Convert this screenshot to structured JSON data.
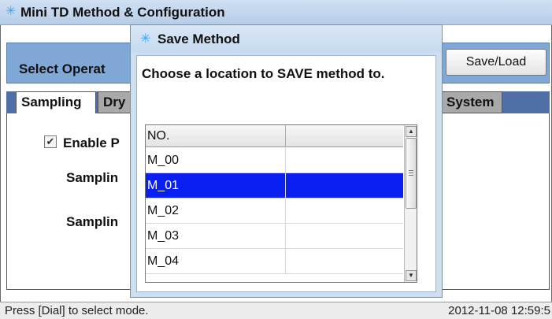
{
  "main_window": {
    "title": "Mini TD Method & Configuration",
    "select_operation_label": "Select Operat",
    "saveload_label": "Save/Load",
    "tabs": [
      {
        "label": "Sampling",
        "active": true
      },
      {
        "label": "Dry",
        "active": false
      },
      {
        "label": "System",
        "active": false
      }
    ],
    "enable_label": "Enable P",
    "enable_checked": true,
    "sampling_label_1": "Samplin",
    "sampling_label_2": "Samplin"
  },
  "status_bar": {
    "message": "Press [Dial] to select mode.",
    "datetime": "2012-11-08 12:59:5"
  },
  "dialog": {
    "title": "Save Method",
    "prompt": "Choose a location to SAVE method to.",
    "table": {
      "columns": [
        "NO.",
        ""
      ],
      "rows": [
        {
          "no": "M_00",
          "value": "",
          "selected": false
        },
        {
          "no": "M_01",
          "value": "",
          "selected": true
        },
        {
          "no": "M_02",
          "value": "",
          "selected": false
        },
        {
          "no": "M_03",
          "value": "",
          "selected": false
        },
        {
          "no": "M_04",
          "value": "",
          "selected": false
        }
      ]
    }
  },
  "colors": {
    "selection": "#0a1ff2",
    "title_bar": "#c6d9ef",
    "operation_bar": "#7fa8d6",
    "tab_strip": "#4f6fa6"
  },
  "icons": {
    "title_icon": "sun-icon",
    "checkbox": "checkbox-checked-icon",
    "scroll_up": "arrow-up-icon",
    "scroll_down": "arrow-down-icon"
  }
}
